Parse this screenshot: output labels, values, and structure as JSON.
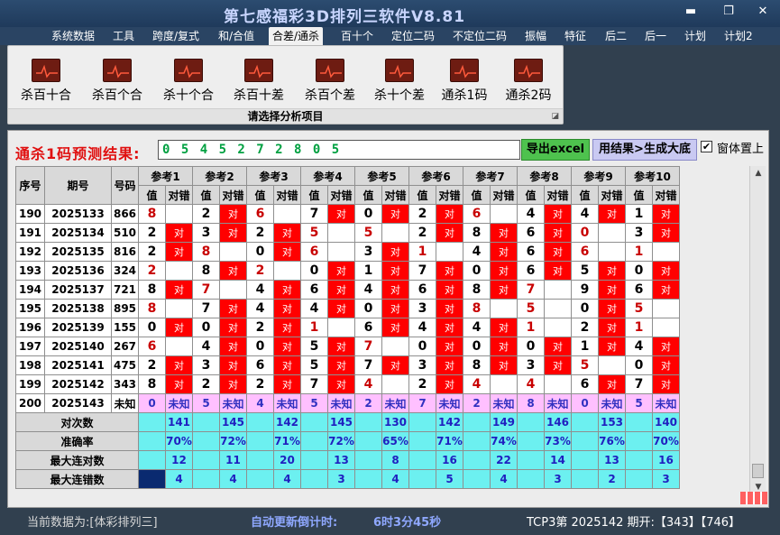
{
  "window": {
    "title": "第七感福彩3D排列三软件V8.81",
    "min": "▬",
    "restore": "❐",
    "close": "✕"
  },
  "menu": [
    "系统数据",
    "工具",
    "跨度/复式",
    "和/合值",
    "合差/通杀",
    "百十个",
    "定位二码",
    "不定位二码",
    "振幅",
    "特征",
    "后二",
    "后一",
    "计划",
    "计划2"
  ],
  "ribbon": {
    "buttons": [
      "杀百十合",
      "杀百个合",
      "杀十个合",
      "杀百十差",
      "杀百个差",
      "杀十个差",
      "通杀1码",
      "通杀2码"
    ],
    "group_label": "请选择分析项目",
    "launcher": "◪"
  },
  "prediction": {
    "label": "通杀1码预测结果:",
    "value": "0 5 4 5 2 7 2 8 0 5",
    "excel_button": "导出excel",
    "gen_button": "用结果>生成大底",
    "pin_label": "窗体置上",
    "pin_checked": "✔"
  },
  "table": {
    "col_headers": {
      "seq": "序号",
      "period": "期号",
      "number": "号码"
    },
    "ref_headers": [
      "参考1",
      "参考2",
      "参考3",
      "参考4",
      "参考5",
      "参考6",
      "参考7",
      "参考8",
      "参考9",
      "参考10"
    ],
    "sub_val": "值",
    "sub_hit": "对错",
    "hit_mark": "对",
    "unknown": "未知",
    "rows": [
      {
        "seq": "190",
        "period": "2025133",
        "number": "866",
        "vals": [
          "8",
          "2",
          "6",
          "7",
          "0",
          "2",
          "6",
          "4",
          "4",
          "1"
        ],
        "hits": [
          0,
          1,
          0,
          1,
          1,
          1,
          0,
          1,
          1,
          1
        ]
      },
      {
        "seq": "191",
        "period": "2025134",
        "number": "510",
        "vals": [
          "2",
          "3",
          "2",
          "5",
          "5",
          "2",
          "8",
          "6",
          "0",
          "3"
        ],
        "hits": [
          1,
          1,
          1,
          0,
          0,
          1,
          1,
          1,
          0,
          1
        ]
      },
      {
        "seq": "192",
        "period": "2025135",
        "number": "816",
        "vals": [
          "2",
          "8",
          "0",
          "6",
          "3",
          "1",
          "4",
          "6",
          "6",
          "1"
        ],
        "hits": [
          1,
          0,
          1,
          0,
          1,
          0,
          1,
          1,
          0,
          0
        ]
      },
      {
        "seq": "193",
        "period": "2025136",
        "number": "324",
        "vals": [
          "2",
          "8",
          "2",
          "0",
          "1",
          "7",
          "0",
          "6",
          "5",
          "0"
        ],
        "hits": [
          0,
          1,
          0,
          1,
          1,
          1,
          1,
          1,
          1,
          1
        ]
      },
      {
        "seq": "194",
        "period": "2025137",
        "number": "721",
        "vals": [
          "8",
          "7",
          "4",
          "6",
          "4",
          "6",
          "8",
          "7",
          "9",
          "6"
        ],
        "hits": [
          1,
          0,
          1,
          1,
          1,
          1,
          1,
          0,
          1,
          1
        ]
      },
      {
        "seq": "195",
        "period": "2025138",
        "number": "895",
        "vals": [
          "8",
          "7",
          "4",
          "4",
          "0",
          "3",
          "8",
          "5",
          "0",
          "5"
        ],
        "hits": [
          0,
          1,
          1,
          1,
          1,
          1,
          0,
          0,
          1,
          0
        ]
      },
      {
        "seq": "196",
        "period": "2025139",
        "number": "155",
        "vals": [
          "0",
          "0",
          "2",
          "1",
          "6",
          "4",
          "4",
          "1",
          "2",
          "1"
        ],
        "hits": [
          1,
          1,
          1,
          0,
          1,
          1,
          1,
          0,
          1,
          0
        ]
      },
      {
        "seq": "197",
        "period": "2025140",
        "number": "267",
        "vals": [
          "6",
          "4",
          "0",
          "5",
          "7",
          "0",
          "0",
          "0",
          "1",
          "4"
        ],
        "hits": [
          0,
          1,
          1,
          1,
          0,
          1,
          1,
          1,
          1,
          1
        ]
      },
      {
        "seq": "198",
        "period": "2025141",
        "number": "475",
        "vals": [
          "2",
          "3",
          "6",
          "5",
          "7",
          "3",
          "8",
          "3",
          "5",
          "0"
        ],
        "hits": [
          1,
          1,
          1,
          1,
          1,
          1,
          1,
          1,
          0,
          1
        ]
      },
      {
        "seq": "199",
        "period": "2025142",
        "number": "343",
        "vals": [
          "8",
          "2",
          "2",
          "7",
          "4",
          "2",
          "4",
          "4",
          "6",
          "7"
        ],
        "hits": [
          1,
          1,
          1,
          1,
          0,
          1,
          0,
          0,
          1,
          1
        ]
      }
    ],
    "predict_row": {
      "seq": "200",
      "period": "2025143",
      "number": "未知",
      "vals": [
        "0",
        "5",
        "4",
        "5",
        "2",
        "7",
        "2",
        "8",
        "0",
        "5"
      ]
    },
    "stats": [
      {
        "label": "对次数",
        "values": [
          "141",
          "145",
          "142",
          "145",
          "130",
          "142",
          "149",
          "146",
          "153",
          "140"
        ]
      },
      {
        "label": "准确率",
        "values": [
          "70%",
          "72%",
          "71%",
          "72%",
          "65%",
          "71%",
          "74%",
          "73%",
          "76%",
          "70%"
        ]
      },
      {
        "label": "最大连对数",
        "values": [
          "12",
          "11",
          "20",
          "13",
          "8",
          "16",
          "22",
          "14",
          "13",
          "16"
        ]
      },
      {
        "label": "最大连错数",
        "values": [
          "4",
          "4",
          "4",
          "3",
          "4",
          "5",
          "4",
          "3",
          "2",
          "3"
        ]
      }
    ]
  },
  "status": {
    "current_data": "当前数据为:[体彩排列三]",
    "countdown_label": "自动更新倒计时:",
    "countdown": "6时3分45秒",
    "draw_info": "TCP3第 2025142 期开:【343】【746】"
  },
  "colors": {
    "hit": "#ff0000",
    "predict_row": "#ffc0ff",
    "stats": "#6cf0f0",
    "pred_text": "#00a040",
    "pred_label": "#e01010"
  }
}
